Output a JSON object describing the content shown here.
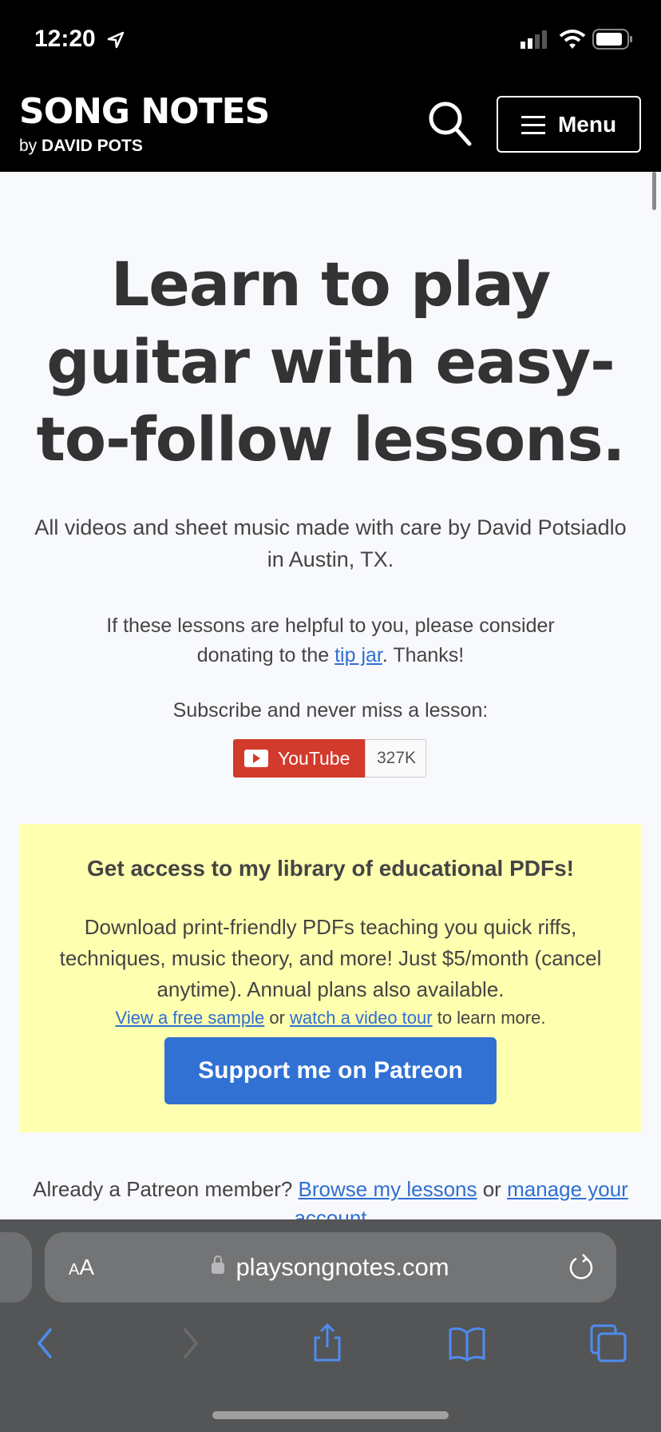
{
  "status_bar": {
    "time": "12:20"
  },
  "header": {
    "logo": "SONG NOTES",
    "byline_prefix": "by",
    "byline_name": "DAVID POTS",
    "menu_label": "Menu"
  },
  "hero": {
    "title": "Learn to play guitar with easy-to-follow lessons.",
    "intro": "All videos and sheet music made with care by David Potsiadlo in Austin, TX.",
    "donate_prefix": "If these lessons are helpful to you, please consider donating to the ",
    "donate_link": "tip jar",
    "donate_suffix": ". Thanks!",
    "subscribe": "Subscribe and never miss a lesson:",
    "youtube_label": "YouTube",
    "youtube_count": "327K"
  },
  "promo": {
    "heading": "Get access to my library of educational PDFs!",
    "body": "Download print-friendly PDFs teaching you quick riffs, techniques, music theory, and more! Just $5/month (cancel anytime). Annual plans also available.",
    "sample_link": "View a free sample",
    "or": " or ",
    "tour_link": "watch a video tour",
    "suffix": " to learn more.",
    "button": "Support me on Patreon"
  },
  "member": {
    "prefix": "Already a Patreon member? ",
    "browse_link": "Browse my lessons",
    "or": " or ",
    "manage_link": "manage your account"
  },
  "browser": {
    "aa_small": "A",
    "aa_large": "A",
    "url": "playsongnotes.com"
  },
  "colors": {
    "link": "#2f6fd1",
    "promo_bg": "#ffffb0",
    "button": "#3171d3",
    "youtube": "#d23a2c"
  }
}
